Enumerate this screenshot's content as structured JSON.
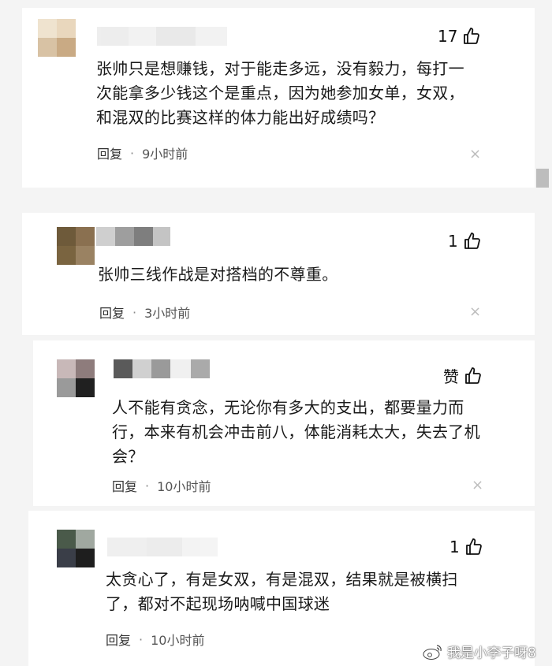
{
  "comments": [
    {
      "likes": "17",
      "text_lines": [
        "张帅只是想赚钱，对于能走多远，没有毅力，每打一",
        "次能拿多少钱这个是重点，因为她参加女单，女双，",
        "和混双的比赛这样的体力能出好成绩吗？"
      ],
      "reply_label": "回复",
      "time": "9小时前"
    },
    {
      "likes": "1",
      "text_lines": [
        "张帅三线作战是对搭档的不尊重。"
      ],
      "reply_label": "回复",
      "time": "3小时前"
    },
    {
      "likes": "赞",
      "text_lines": [
        "人不能有贪念，无论你有多大的支出，都要量力而",
        "行，本来有机会冲击前八，体能消耗太大，失去了机",
        "会？"
      ],
      "reply_label": "回复",
      "time": "10小时前"
    },
    {
      "likes": "1",
      "text_lines": [
        "太贪心了，有是女双，有是混双，结果就是被横扫",
        "了，都对不起现场呐喊中国球迷"
      ],
      "reply_label": "回复",
      "time": "10小时前"
    }
  ],
  "separator": "·",
  "close_glyph": "×",
  "watermark": {
    "text": "我是小李子呀8"
  },
  "colors": {
    "background": "#f4f4f4",
    "card": "#ffffff",
    "muted": "#555555",
    "close": "#bdbdbd"
  }
}
